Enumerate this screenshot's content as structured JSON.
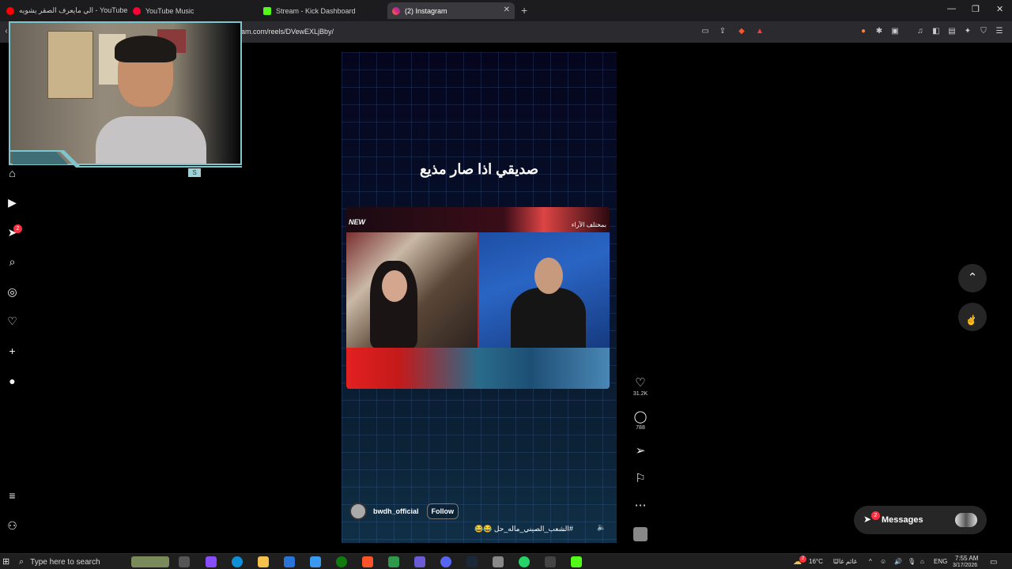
{
  "browser": {
    "tabs": [
      {
        "label": "الي مايعرف الصقر يشويه - YouTube",
        "favicon_color": "#ff0000"
      },
      {
        "label": "YouTube Music",
        "favicon_color": "#ff0033"
      },
      {
        "label": "Stream - Kick Dashboard",
        "favicon_color": "#53fc18"
      },
      {
        "label": "(2) Instagram",
        "favicon_color": "#e1306c",
        "active": true
      }
    ],
    "new_tab_icon": "+",
    "url": "ram.com/reels/DVewEXLjBby/",
    "window_controls": [
      "minimize-icon",
      "restore-icon",
      "close-icon"
    ]
  },
  "sidebar": {
    "items": [
      {
        "name": "home-icon"
      },
      {
        "name": "reels-icon"
      },
      {
        "name": "direct-icon",
        "badge": "2"
      },
      {
        "name": "search-icon"
      },
      {
        "name": "explore-icon"
      },
      {
        "name": "notifications-heart-icon"
      },
      {
        "name": "create-plus-icon"
      },
      {
        "name": "profile-avatar"
      }
    ],
    "bottom": [
      {
        "name": "more-menu-icon"
      },
      {
        "name": "also-from-meta-icon"
      }
    ]
  },
  "webcam": {
    "tag": "S"
  },
  "reel": {
    "caption": "صديقي اذا صار مذيع",
    "clip": {
      "logo": "NEW",
      "show_title": "بمختلف الآراء"
    },
    "username": "bwdh_official",
    "follow_label": "Follow",
    "hashtag": "#الشعب_الصيني_ماله_حل 😂😂",
    "likes": "31.2K",
    "comments": "788"
  },
  "nav": {
    "up_icon": "chevron-up-icon",
    "down_icon": "chevron-down-icon"
  },
  "messages": {
    "label": "Messages",
    "badge": "2"
  },
  "taskbar": {
    "search_placeholder": "Type here to search",
    "weather_temp": "16°C",
    "weather_desc": "غائم غالبًا",
    "weather_badge": "2",
    "language": "ENG",
    "time": "7:55 AM",
    "date": "3/17/2026"
  }
}
